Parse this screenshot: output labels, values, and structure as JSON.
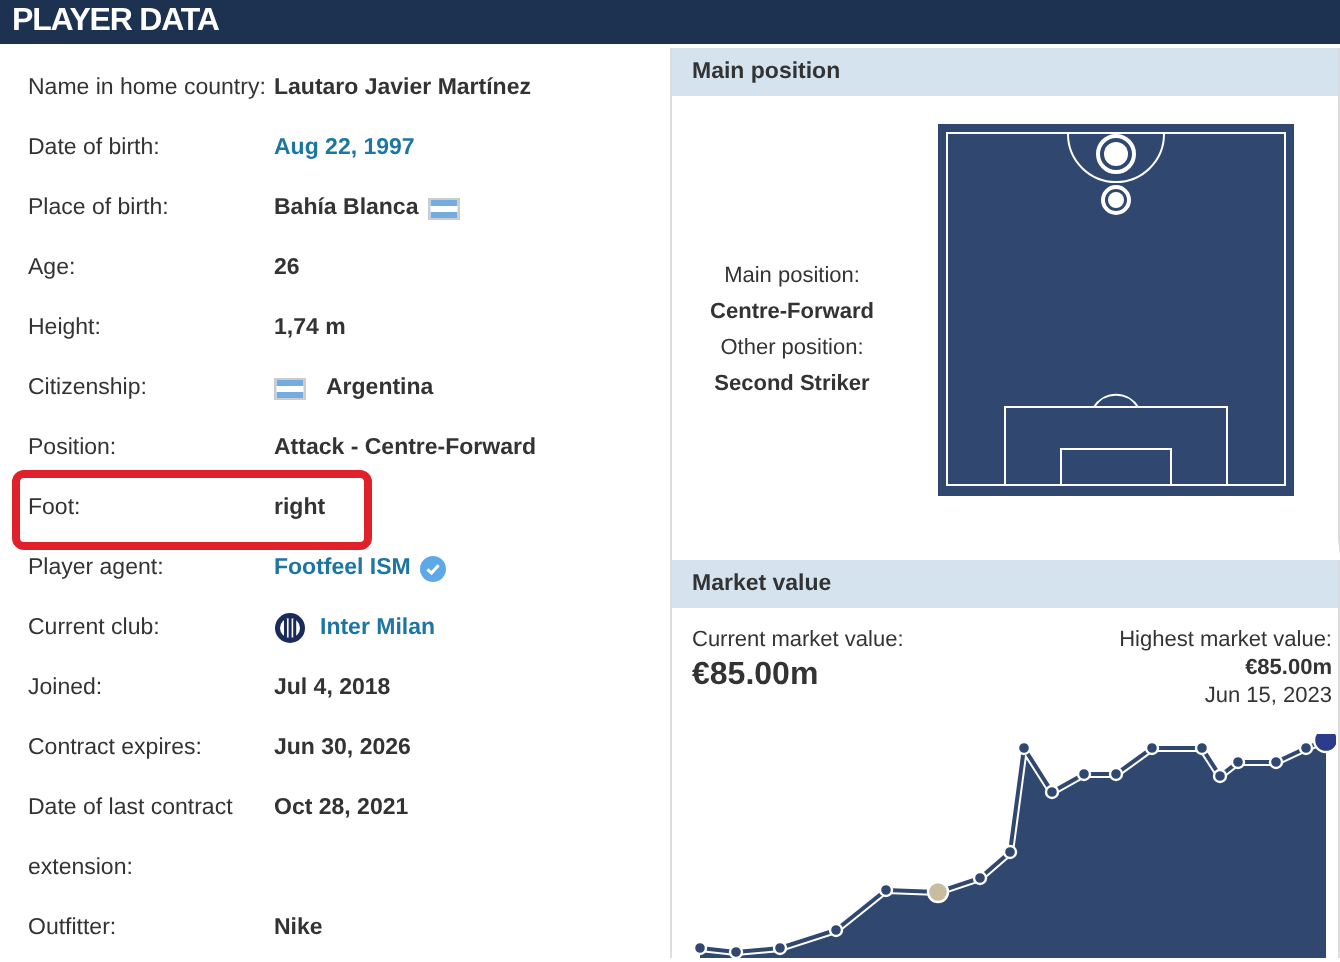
{
  "header": {
    "title": "PLAYER DATA"
  },
  "info_rows": [
    {
      "label": "Name in home country:",
      "value": "Lautaro Javier Martínez",
      "kind": "text",
      "highlighted": false
    },
    {
      "label": "Date of birth:",
      "value": "Aug 22, 1997",
      "kind": "link",
      "highlighted": false
    },
    {
      "label": "Place of birth:",
      "value": "Bahía Blanca",
      "kind": "flag_after",
      "highlighted": false
    },
    {
      "label": "Age:",
      "value": "26",
      "kind": "text",
      "highlighted": false
    },
    {
      "label": "Height:",
      "value": "1,74 m",
      "kind": "text",
      "highlighted": false
    },
    {
      "label": "Citizenship:",
      "value": "Argentina",
      "kind": "flag_before",
      "highlighted": false
    },
    {
      "label": "Position:",
      "value": "Attack - Centre-Forward",
      "kind": "text",
      "highlighted": false
    },
    {
      "label": "Foot:",
      "value": "right",
      "kind": "text",
      "highlighted": true
    },
    {
      "label": "Player agent:",
      "value": "Footfeel ISM",
      "kind": "verified_link",
      "highlighted": false
    },
    {
      "label": "Current club:",
      "value": "Inter Milan",
      "kind": "club_link",
      "highlighted": false
    },
    {
      "label": "Joined:",
      "value": "Jul 4, 2018",
      "kind": "text",
      "highlighted": false
    },
    {
      "label": "Contract expires:",
      "value": "Jun 30, 2026",
      "kind": "text",
      "highlighted": false
    },
    {
      "label": "Date of last contract extension:",
      "value": "Oct 28, 2021",
      "kind": "text",
      "highlighted": false
    },
    {
      "label": "Outfitter:",
      "value": "Nike",
      "kind": "text",
      "highlighted": false
    }
  ],
  "main_position": {
    "title": "Main position",
    "main_label": "Main position:",
    "main_value": "Centre-Forward",
    "other_label": "Other position:",
    "other_value": "Second Striker"
  },
  "market_value": {
    "title": "Market value",
    "current_label": "Current market value:",
    "current_value": "€85.00m",
    "highest_label": "Highest market value:",
    "highest_value": "€85.00m",
    "highest_date": "Jun 15, 2023"
  }
}
